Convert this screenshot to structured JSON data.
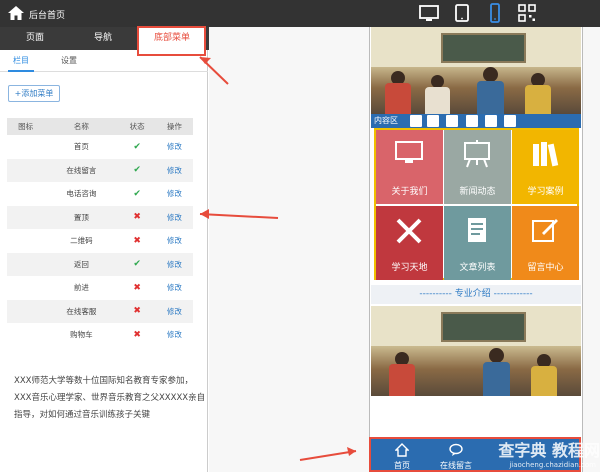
{
  "topbar": {
    "home_label": "后台首页",
    "devices": [
      "desktop-icon",
      "tablet-icon",
      "phone-icon",
      "qr-code-icon"
    ]
  },
  "panel": {
    "tabs": [
      "页面",
      "导航",
      "底部菜单"
    ],
    "close": "✕",
    "subtabs": [
      "栏目",
      "设置"
    ],
    "add_button": "+添加菜单",
    "columns": [
      "图标",
      "名称",
      "状态",
      "操作"
    ],
    "rows": [
      {
        "name": "首页",
        "status": "✔",
        "action": "修改"
      },
      {
        "name": "在线留言",
        "status": "✔",
        "action": "修改"
      },
      {
        "name": "电话咨询",
        "status": "✔",
        "action": "修改"
      },
      {
        "name": "置顶",
        "status": "✖",
        "action": "修改"
      },
      {
        "name": "二维码",
        "status": "✖",
        "action": "修改"
      },
      {
        "name": "返回",
        "status": "✔",
        "action": "修改"
      },
      {
        "name": "前进",
        "status": "✖",
        "action": "修改"
      },
      {
        "name": "在线客服",
        "status": "✖",
        "action": "修改"
      },
      {
        "name": "购物车",
        "status": "✖",
        "action": "修改"
      }
    ]
  },
  "preview": {
    "toolbar_label": "内容区",
    "tiles": [
      {
        "label": "关于我们",
        "color": "#d9646a",
        "icon": "monitor-icon"
      },
      {
        "label": "新闻动态",
        "color": "#9aa8a3",
        "icon": "easel-icon"
      },
      {
        "label": "学习案例",
        "color": "#f2b600",
        "icon": "books-icon"
      },
      {
        "label": "学习天地",
        "color": "#c0383e",
        "icon": "tools-icon"
      },
      {
        "label": "文章列表",
        "color": "#6f9a9e",
        "icon": "document-icon"
      },
      {
        "label": "留言中心",
        "color": "#f08a1a",
        "icon": "edit-icon"
      }
    ],
    "section_title": "---------- 专业介绍 ------------",
    "article": "XXX师范大学等数十位国际知名教育专家参加，XXX音乐心理学家、世界音乐教育之父XXXXX亲自指导，对如何通过音乐训练孩子关键",
    "bottom_menu": [
      {
        "label": "首页",
        "icon": "home-icon"
      },
      {
        "label": "在线留言",
        "icon": "chat-icon"
      }
    ]
  },
  "watermark": {
    "main": "查字典 教程网",
    "sub": "jiaocheng.chazidian.com"
  },
  "colors": {
    "accent": "#2b6cb0",
    "highlight": "#e74c3c",
    "ok": "#2fa84f",
    "no": "#e03030"
  }
}
